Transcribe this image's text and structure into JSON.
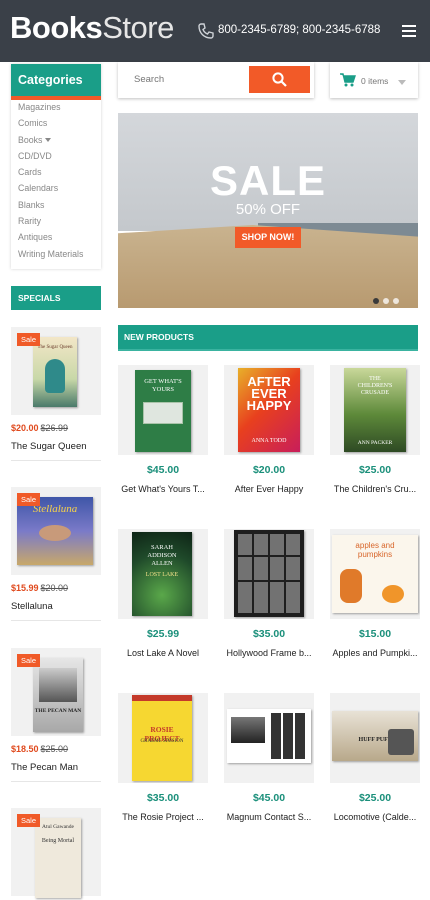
{
  "header": {
    "logo_bold": "Books",
    "logo_light": "Store",
    "phone": "800-2345-6789; 800-2345-6788"
  },
  "search": {
    "placeholder": "Search"
  },
  "cart": {
    "label": "0 items"
  },
  "categories": {
    "title": "Categories",
    "items": [
      "Magazines",
      "Comics",
      "Books",
      "CD/DVD",
      "Cards",
      "Calendars",
      "Blanks",
      "Rarity",
      "Antiques",
      "Writing Materials"
    ]
  },
  "specials": {
    "title": "SPECIALS",
    "items": [
      {
        "sale": "Sale",
        "price": "$20.00",
        "old_price": "$26.99",
        "title": "The Sugar Queen"
      },
      {
        "sale": "Sale",
        "price": "$15.99",
        "old_price": "$20.00",
        "title": "Stellaluna"
      },
      {
        "sale": "Sale",
        "price": "$18.50",
        "old_price": "$25.00",
        "title": "The Pecan Man"
      },
      {
        "sale": "Sale"
      }
    ]
  },
  "banner": {
    "title": "SALE",
    "subtitle": "50% OFF",
    "button": "SHOP NOW!"
  },
  "new_products": {
    "title": "NEW PRODUCTS",
    "items": [
      {
        "price": "$45.00",
        "name": "Get What's Yours T..."
      },
      {
        "price": "$20.00",
        "name": "After Ever Happy"
      },
      {
        "price": "$25.00",
        "name": "The Children's Cru..."
      },
      {
        "price": "$25.99",
        "name": "Lost Lake A Novel"
      },
      {
        "price": "$35.00",
        "name": "Hollywood Frame b..."
      },
      {
        "price": "$15.00",
        "name": "Apples and Pumpki..."
      },
      {
        "price": "$35.00",
        "name": "The Rosie Project ..."
      },
      {
        "price": "$45.00",
        "name": "Magnum Contact S..."
      },
      {
        "price": "$25.00",
        "name": "Locomotive (Calde..."
      }
    ]
  },
  "covers": {
    "sugar_queen": "The Sugar Queen",
    "stellaluna": "Stellaluna",
    "pecan": "THE PECAN MAN",
    "mortal_author": "Atul Gawande",
    "mortal_title": "Being Mortal",
    "gwy": "GET WHAT'S YOURS",
    "after": "AFTER EVER HAPPY",
    "after_author": "ANNA TODD",
    "crusade": "THE CHILDREN'S CRUSADE",
    "crusade_author": "ANN PACKER",
    "lost_author": "SARAH ADDISON ALLEN",
    "lost_title": "LOST LAKE",
    "apples": "apples and pumpkins",
    "rosie_title": "ROSIE PROJECT",
    "rosie_author": "GRAEME SIMSION",
    "huff": "HUFF PUFF"
  }
}
